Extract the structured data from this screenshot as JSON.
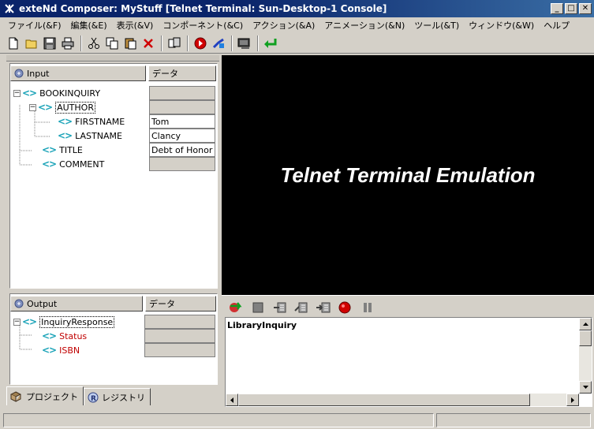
{
  "window": {
    "title": "exteNd Composer: MyStuff [Telnet Terminal: Sun-Desktop-1 Console]",
    "minimize": "_",
    "maximize": "□",
    "close": "✕"
  },
  "menu": {
    "items": [
      "ファイル(&F)",
      "編集(&E)",
      "表示(&V)",
      "コンポーネント(&C)",
      "アクション(&A)",
      "アニメーション(&N)",
      "ツール(&T)",
      "ウィンドウ(&W)",
      "ヘルプ"
    ]
  },
  "toolbar": {
    "icons": [
      "new-icon",
      "open-icon",
      "save-icon",
      "print-icon",
      "cut-icon",
      "copy-icon",
      "paste-icon",
      "delete-icon",
      "find-icon",
      "record-icon",
      "connect-icon",
      "screen-icon",
      "return-icon"
    ]
  },
  "input_panel": {
    "header": "Input",
    "data_header": "データ",
    "rows": [
      {
        "label": "BOOKINQUIRY",
        "value": ""
      },
      {
        "label": "AUTHOR",
        "value": ""
      },
      {
        "label": "FIRSTNAME",
        "value": "Tom"
      },
      {
        "label": "LASTNAME",
        "value": "Clancy"
      },
      {
        "label": "TITLE",
        "value": "Debt of Honor"
      },
      {
        "label": "COMMENT",
        "value": ""
      }
    ]
  },
  "output_panel": {
    "header": "Output",
    "data_header": "データ",
    "rows": [
      {
        "label": "InquiryResponse",
        "value": ""
      },
      {
        "label": "Status",
        "value": ""
      },
      {
        "label": "ISBN",
        "value": ""
      }
    ]
  },
  "tabs": {
    "project": "プロジェクト",
    "registry": "レジストリ"
  },
  "terminal": {
    "text": "Telnet Terminal Emulation"
  },
  "action_panel": {
    "title": "LibraryInquiry"
  },
  "colors": {
    "title_bar": "#0a246a",
    "tag_icon": "#1ba3b8",
    "required_field": "#c00000",
    "terminal_bg": "#000000"
  }
}
